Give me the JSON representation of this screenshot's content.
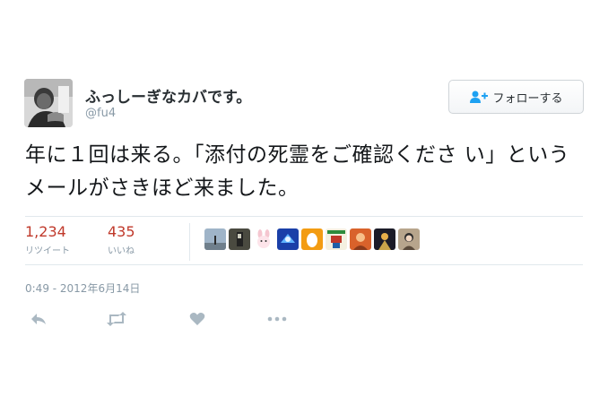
{
  "tweet": {
    "display_name": "ふっしーぎなカバです。",
    "screen_name": "@fu4",
    "follow_label": "フォローする",
    "text": "年に１回は来る。「添付の死霊をご確認くださ い」というメールがさきほど来ました。",
    "retweets": {
      "count": "1,234",
      "label": "リツイート"
    },
    "likes": {
      "count": "435",
      "label": "いいね"
    },
    "timestamp": "0:49 - 2012年6月14日"
  },
  "liker_avatars": [
    "avatar-figure-sky",
    "avatar-dark-portrait",
    "avatar-rabbit-pink",
    "avatar-blue-bird",
    "avatar-egg-orange",
    "avatar-game-sprite",
    "avatar-orange-character",
    "avatar-night-figure",
    "avatar-illustration"
  ],
  "actions": [
    {
      "name": "reply-icon"
    },
    {
      "name": "retweet-icon"
    },
    {
      "name": "like-heart-icon"
    },
    {
      "name": "more-dots-icon"
    }
  ],
  "colors": {
    "stat_count": "#c0392b",
    "muted": "#8899a6",
    "divider": "#e1e8ed",
    "follow_icon": "#1da1f2"
  }
}
